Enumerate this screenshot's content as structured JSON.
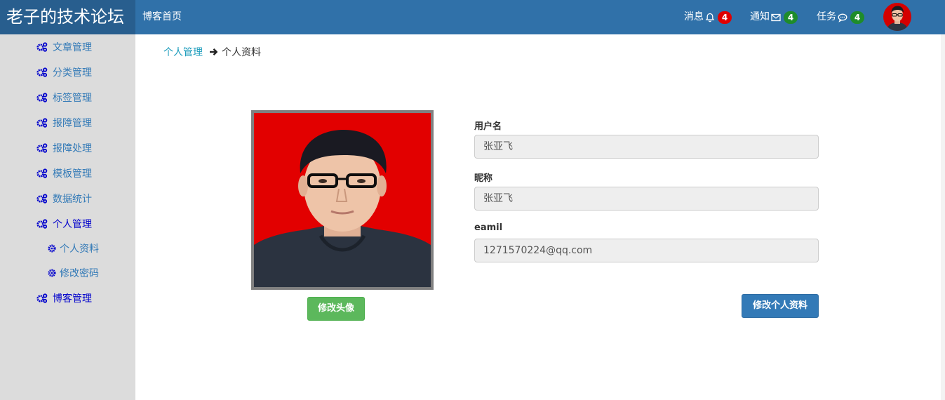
{
  "navbar": {
    "brand": "老子的技术论坛",
    "home_link": "博客首页",
    "items": [
      {
        "label": "消息",
        "icon": "bell-icon",
        "count": "4",
        "badge_color": "#e00000"
      },
      {
        "label": "通知",
        "icon": "envelope-icon",
        "count": "4",
        "badge_color": "#1e8c2a"
      },
      {
        "label": "任务",
        "icon": "comment-icon",
        "count": "4",
        "badge_color": "#1e8c2a"
      }
    ],
    "avatar_icon": "user-avatar"
  },
  "sidebar": {
    "items": [
      {
        "label": "文章管理",
        "icon": "gears-icon"
      },
      {
        "label": "分类管理",
        "icon": "gears-icon"
      },
      {
        "label": "标签管理",
        "icon": "gears-icon"
      },
      {
        "label": "报障管理",
        "icon": "gears-icon"
      },
      {
        "label": "报障处理",
        "icon": "gears-icon"
      },
      {
        "label": "模板管理",
        "icon": "gears-icon"
      },
      {
        "label": "数据统计",
        "icon": "gears-icon"
      },
      {
        "label": "个人管理",
        "icon": "gears-icon",
        "active": true
      },
      {
        "label": "博客管理",
        "icon": "gears-icon"
      }
    ],
    "sub_items": [
      {
        "label": "个人资料",
        "icon": "cog-icon"
      },
      {
        "label": "修改密码",
        "icon": "cog-icon"
      }
    ]
  },
  "breadcrumb": {
    "parent": "个人管理",
    "current": "个人资料"
  },
  "profile": {
    "change_avatar_button": "修改头像",
    "fields": [
      {
        "label": "用户名",
        "value": "张亚飞"
      },
      {
        "label": "昵称",
        "value": "张亚飞"
      },
      {
        "label": "eamil",
        "value": "1271570224@qq.com"
      }
    ],
    "submit_button": "修改个人资料"
  },
  "colors": {
    "navbar": "#3071a9",
    "brand": "#285e8e",
    "sidebar": "#dcdcdc",
    "link": "#337ab7",
    "green_button": "#5cb85c",
    "blue_button": "#337ab7"
  }
}
